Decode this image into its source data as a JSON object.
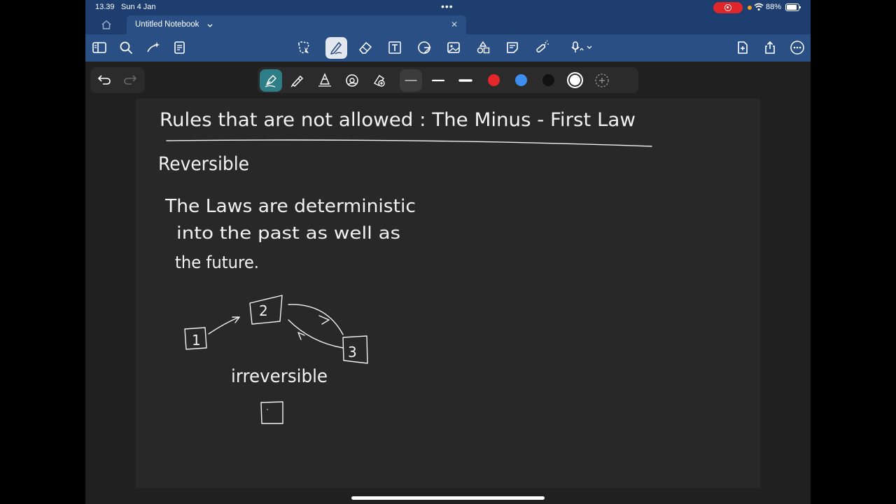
{
  "status_bar": {
    "time": "13.39",
    "date": "Sun 4 Jan",
    "battery_percent": "88%"
  },
  "tab": {
    "title": "Untitled Notebook"
  },
  "toolbar": {
    "left_icons": [
      "sidebar-icon",
      "search-icon",
      "sparkle-wand-icon",
      "document-list-icon"
    ],
    "center_icons": [
      "lasso-select-icon",
      "pen-icon",
      "eraser-icon",
      "text-box-icon",
      "shapes-icon",
      "image-icon",
      "stickers-icon",
      "sticky-note-icon",
      "laser-pointer-icon",
      "microphone-icon"
    ],
    "right_icons": [
      "add-page-icon",
      "share-icon",
      "more-icon"
    ],
    "active_tool": "pen"
  },
  "pen_bar": {
    "tools": [
      "fountain-pen-icon",
      "ballpoint-pen-icon",
      "brush-pen-icon",
      "pen-settings-icon",
      "pen-favorites-icon"
    ],
    "widths": [
      "thin",
      "medium",
      "thick"
    ],
    "selected_width": "thin",
    "colors": [
      "#e5262b",
      "#3d8ef0",
      "#111111",
      "#ffffff"
    ],
    "selected_color": "#ffffff"
  },
  "notes": {
    "title": "Rules that are not allowed : The Minus - First Law",
    "heading": "Reversible",
    "line1": "The Laws are deterministic",
    "line2": "into the past as well as",
    "line3": "the future.",
    "box1": "1",
    "box2": "2",
    "box3": "3",
    "label": "irreversible"
  }
}
